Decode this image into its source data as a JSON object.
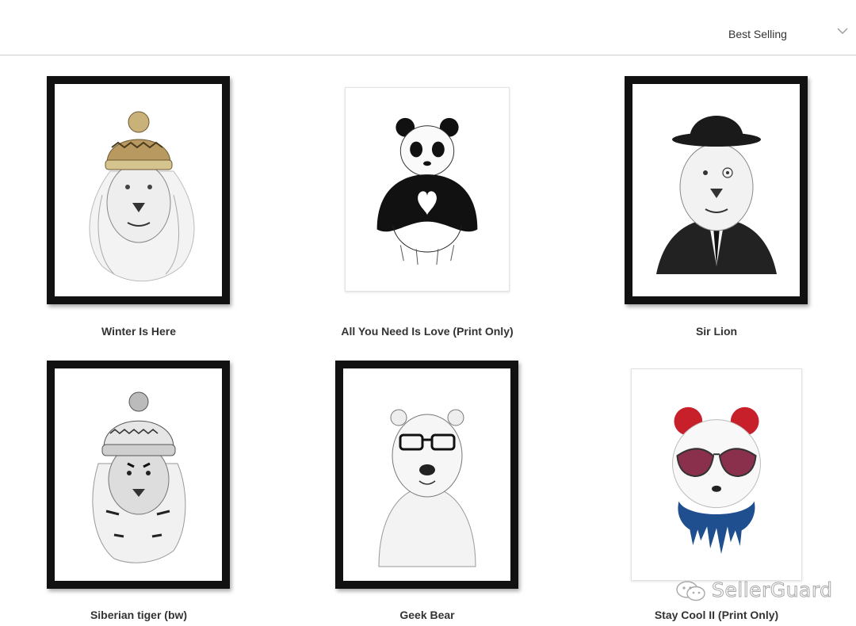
{
  "sort": {
    "selected": "Best Selling",
    "icon": "chevron-down-icon"
  },
  "products": [
    {
      "title": "Winter Is Here",
      "frame": "black",
      "art": "lion with knit beanie"
    },
    {
      "title": "All You Need Is Love (Print Only)",
      "frame": "none",
      "art": "panda making heart with paws"
    },
    {
      "title": "Sir Lion",
      "frame": "black",
      "art": "lion with bowler hat and suit"
    },
    {
      "title": "Siberian tiger (bw)",
      "frame": "black",
      "art": "tiger with pom-pom beanie"
    },
    {
      "title": "Geek Bear",
      "frame": "black",
      "art": "polar bear with glasses"
    },
    {
      "title": "Stay Cool II (Print Only)",
      "frame": "none",
      "art": "panda with aviator sunglasses"
    }
  ],
  "watermark": {
    "text": "SellerGuard",
    "icon": "wechat-icon"
  },
  "colors": {
    "frame": "#111111",
    "divider": "#cfcfcf",
    "panda_ears": "#c8202a",
    "panda_drip": "#1f4f8f",
    "sunglasses": "#8a2f4c"
  }
}
